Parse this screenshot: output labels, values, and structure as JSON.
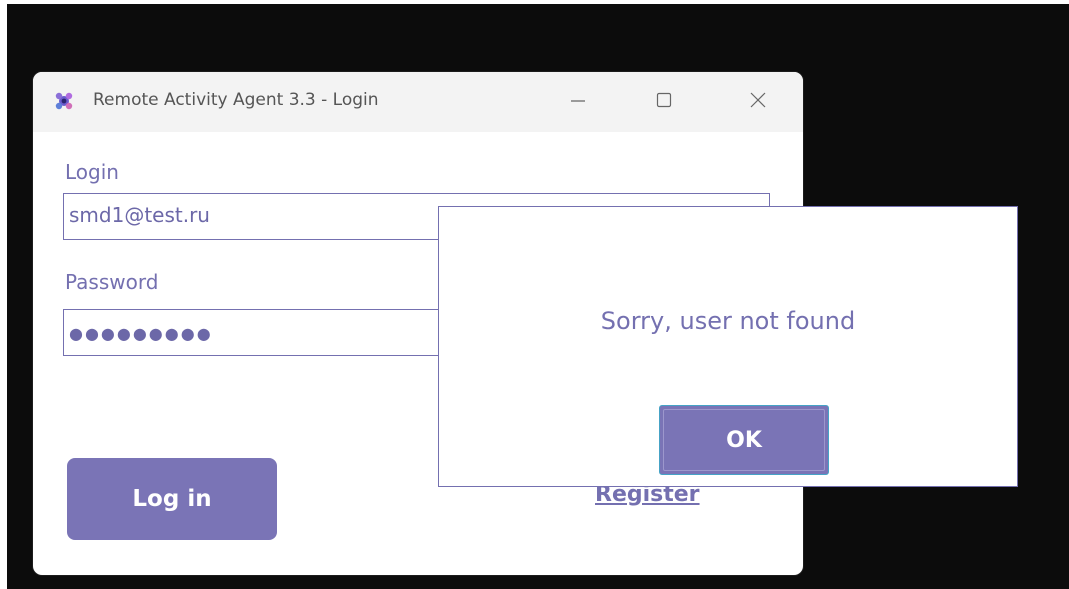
{
  "window": {
    "title": "Remote Activity Agent 3.3 - Login",
    "icon": "app-logo-icon",
    "controls": [
      "minimize-icon",
      "maximize-icon",
      "close-icon"
    ]
  },
  "form": {
    "login_label": "Login",
    "login_value": "smd1@test.ru",
    "password_label": "Password",
    "password_value": "●●●●●●●●●",
    "login_button": "Log in",
    "register_link": "Register"
  },
  "dialog": {
    "message": "Sorry, user not found",
    "ok_button": "OK"
  },
  "colors": {
    "accent": "#7a74b6",
    "text": "#7470b0",
    "desktop": "#0c0c0c",
    "titlebar": "#f3f3f3",
    "ok_focus_border": "#46a3c6"
  }
}
